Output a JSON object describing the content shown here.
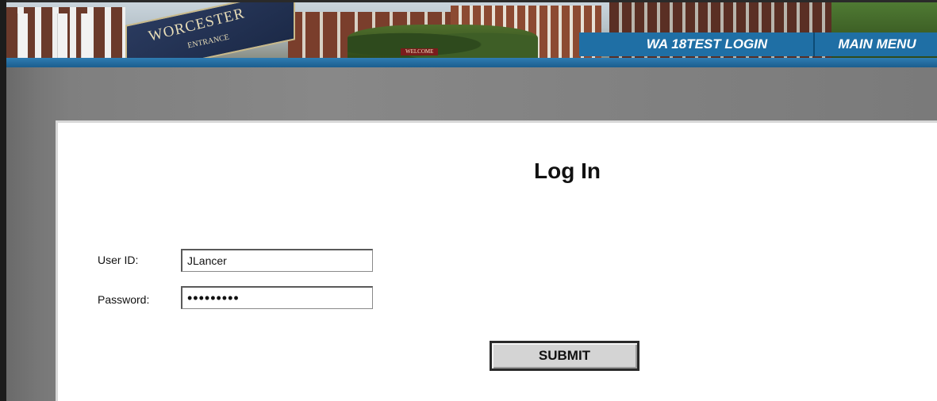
{
  "banner": {
    "sign_text": "WORCESTER",
    "sign_subtext": "ENTRANCE",
    "welcome_text": "WELCOME"
  },
  "nav": {
    "login_tab": "WA 18TEST LOGIN",
    "main_menu_tab": "MAIN MENU"
  },
  "form": {
    "title": "Log In",
    "user_label": "User ID:",
    "user_value": "JLancer",
    "password_label": "Password:",
    "password_value": "password1",
    "submit_label": "SUBMIT"
  },
  "colors": {
    "nav_blue": "#1f6fa5",
    "background_gray": "#7f7f7f"
  }
}
